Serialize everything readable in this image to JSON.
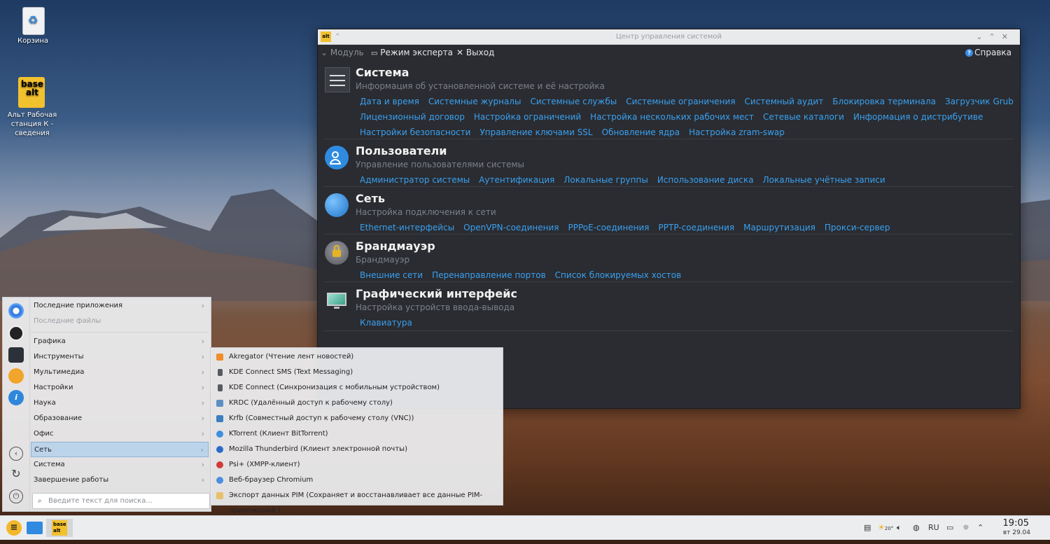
{
  "desktop": {
    "icons": [
      {
        "label": "Корзина"
      },
      {
        "label": "Альт Рабочая станция К - сведения"
      }
    ]
  },
  "window": {
    "title": "Центр управления системой",
    "toolbar": {
      "module": "Модуль",
      "expert": "Режим эксперта",
      "exit": "Выход",
      "help": "Справка"
    },
    "sections": [
      {
        "title": "Система",
        "subtitle": "Информация об установленной системе и её настройка",
        "links": [
          "Дата и время",
          "Системные журналы",
          "Системные службы",
          "Системные ограничения",
          "Системный аудит",
          "Блокировка терминала",
          "Загрузчик Grub",
          "Лицензионный договор",
          "Настройка ограничений",
          "Настройка нескольких рабочих мест",
          "Сетевые каталоги",
          "Информация о дистрибутиве",
          "Настройки безопасности",
          "Управление ключами SSL",
          "Обновление ядра",
          "Настройка zram-swap"
        ]
      },
      {
        "title": "Пользователи",
        "subtitle": "Управление пользователями системы",
        "links": [
          "Администратор системы",
          "Аутентификация",
          "Локальные группы",
          "Использование диска",
          "Локальные учётные записи"
        ]
      },
      {
        "title": "Сеть",
        "subtitle": "Настройка подключения к сети",
        "links": [
          "Ethernet-интерфейсы",
          "OpenVPN-соединения",
          "PPPoE-соединения",
          "PPTP-соединения",
          "Маршрутизация",
          "Прокси-сервер"
        ]
      },
      {
        "title": "Брандмауэр",
        "subtitle": "Брандмауэр",
        "links": [
          "Внешние сети",
          "Перенаправление портов",
          "Список блокируемых хостов"
        ]
      },
      {
        "title": "Графический интерфейс",
        "subtitle": "Настройка устройств ввода-вывода",
        "links": [
          "Клавиатура"
        ]
      }
    ]
  },
  "menu": {
    "items": [
      {
        "label": "Последние приложения"
      },
      {
        "label": "Последние файлы"
      },
      {
        "label": "Графика"
      },
      {
        "label": "Инструменты"
      },
      {
        "label": "Мультимедиа"
      },
      {
        "label": "Настройки"
      },
      {
        "label": "Наука"
      },
      {
        "label": "Образование"
      },
      {
        "label": "Офис"
      },
      {
        "label": "Сеть"
      },
      {
        "label": "Система"
      },
      {
        "label": "Завершение работы"
      }
    ],
    "search_placeholder": "Введите текст для поиска...",
    "submenu": [
      {
        "label": "Akregator (Чтение лент новостей)",
        "color": "#f08c2a"
      },
      {
        "label": "KDE Connect SMS (Text Messaging)",
        "color": "#555a60"
      },
      {
        "label": "KDE Connect (Синхронизация с мобильным устройством)",
        "color": "#555a60"
      },
      {
        "label": "KRDC (Удалённый доступ к рабочему столу)",
        "color": "#5a8fc4"
      },
      {
        "label": "Krfb (Совместный доступ к рабочему столу (VNC))",
        "color": "#3c7fc0"
      },
      {
        "label": "KTorrent (Клиент BitTorrent)",
        "color": "#3d8fe0"
      },
      {
        "label": "Mozilla Thunderbird (Клиент электронной почты)",
        "color": "#2a6bc9"
      },
      {
        "label": "Psi+ (XMPP-клиент)",
        "color": "#d23a3a"
      },
      {
        "label": "Веб-браузер Chromium",
        "color": "#4a8ee0"
      },
      {
        "label": "Экспорт данных PIM (Сохраняет и восстанавливает все данные PIM-приложений.)",
        "color": "#e8c06a"
      }
    ]
  },
  "taskbar": {
    "weather": "20°",
    "lang": "RU",
    "time": "19:05",
    "date": "вт 29.04"
  }
}
